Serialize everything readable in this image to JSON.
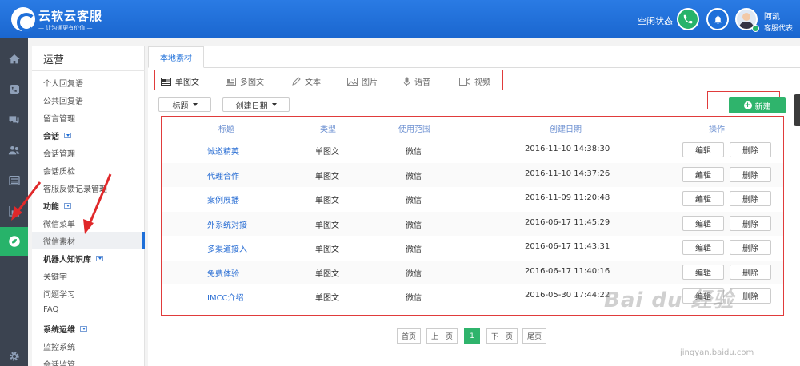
{
  "header": {
    "brand": "云软云客服",
    "slogan": "— 让沟通更有价值 —",
    "status": "空闲状态",
    "user_name": "阿凯",
    "user_role": "客服代表"
  },
  "menu": {
    "title": "运营",
    "items": [
      {
        "label": "个人回复语",
        "type": "item"
      },
      {
        "label": "公共回复语",
        "type": "item"
      },
      {
        "label": "留言管理",
        "type": "item"
      },
      {
        "label": "会话",
        "type": "group"
      },
      {
        "label": "会话管理",
        "type": "item"
      },
      {
        "label": "会话质检",
        "type": "item"
      },
      {
        "label": "客服反馈记录管理",
        "type": "item"
      },
      {
        "label": "功能",
        "type": "group"
      },
      {
        "label": "微信菜单",
        "type": "item"
      },
      {
        "label": "微信素材",
        "type": "item"
      },
      {
        "label": "机器人知识库",
        "type": "group"
      },
      {
        "label": "关键字",
        "type": "item"
      },
      {
        "label": "问题学习",
        "type": "item"
      },
      {
        "label": "FAQ",
        "type": "item"
      },
      {
        "label": "系统运维",
        "type": "group"
      },
      {
        "label": "监控系统",
        "type": "item"
      },
      {
        "label": "会话监管",
        "type": "item"
      }
    ]
  },
  "main": {
    "tab": "本地素材",
    "types": [
      "单图文",
      "多图文",
      "文本",
      "图片",
      "语音",
      "视频"
    ],
    "filter_title": "标题",
    "filter_date": "创建日期",
    "new_label": "新建",
    "columns": [
      "标题",
      "类型",
      "使用范围",
      "创建日期",
      "操作"
    ],
    "edit_label": "编辑",
    "delete_label": "删除",
    "rows": [
      {
        "title": "诚邀精英",
        "type": "单图文",
        "scope": "微信",
        "date": "2016-11-10 14:38:30"
      },
      {
        "title": "代理合作",
        "type": "单图文",
        "scope": "微信",
        "date": "2016-11-10 14:37:26"
      },
      {
        "title": "案例展播",
        "type": "单图文",
        "scope": "微信",
        "date": "2016-11-09 11:20:48"
      },
      {
        "title": "外系统对接",
        "type": "单图文",
        "scope": "微信",
        "date": "2016-06-17 11:45:29"
      },
      {
        "title": "多渠道接入",
        "type": "单图文",
        "scope": "微信",
        "date": "2016-06-17 11:43:31"
      },
      {
        "title": "免费体验",
        "type": "单图文",
        "scope": "微信",
        "date": "2016-06-17 11:40:16"
      },
      {
        "title": "IMCC介绍",
        "type": "单图文",
        "scope": "微信",
        "date": "2016-05-30 17:44:22"
      }
    ],
    "pager": [
      "首页",
      "上一页",
      "1",
      "下一页",
      "尾页"
    ]
  },
  "watermark": {
    "text": "Bai du 经验",
    "url": "jingyan.baidu.com"
  }
}
